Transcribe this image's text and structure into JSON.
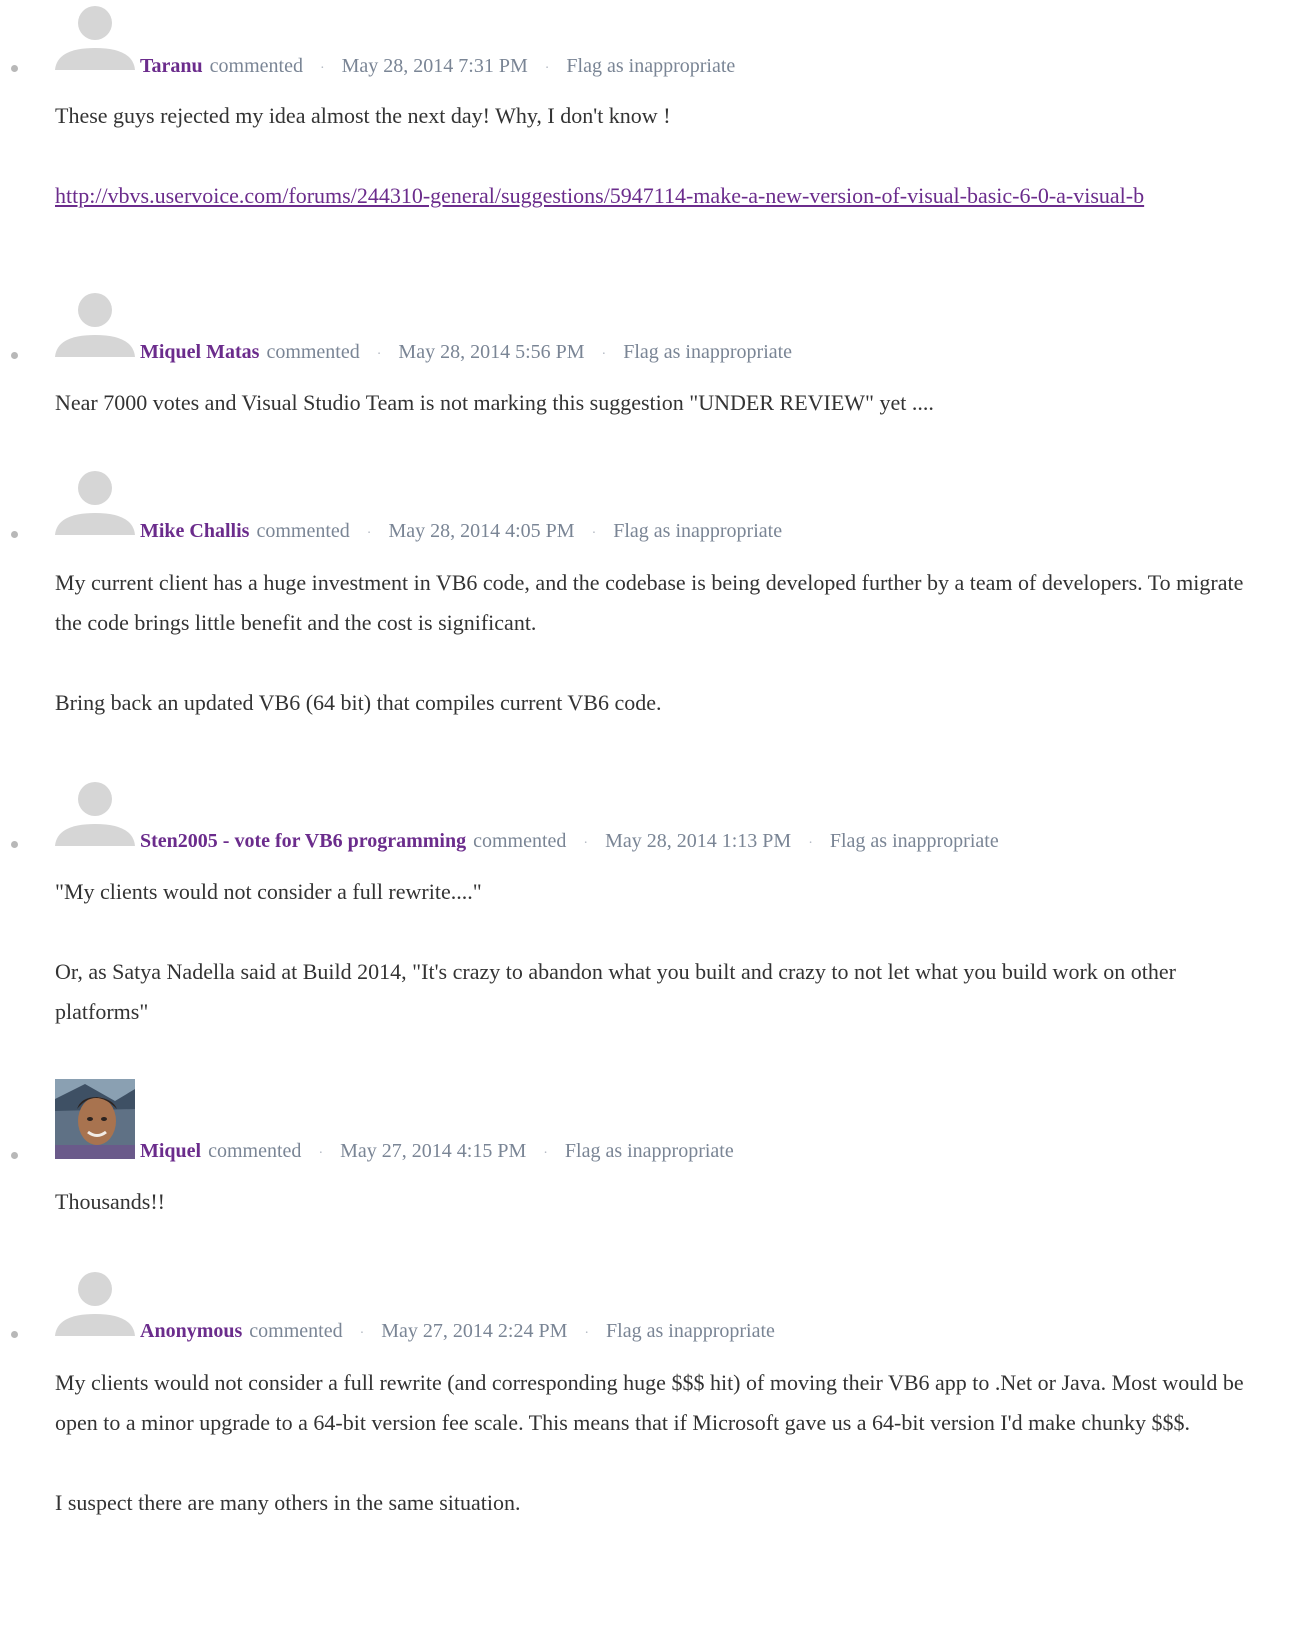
{
  "comments": [
    {
      "author": "Taranu",
      "verb": "commented",
      "date": "May 28, 2014 7:31 PM",
      "flag": "Flag as inappropriate",
      "avatar": "default-avatar",
      "paragraphs": [
        "These guys rejected my idea almost the next day! Why, I don't know !"
      ],
      "link": "http://vbvs.uservoice.com/forums/244310-general/suggestions/5947114-make-a-new-version-of-visual-basic-6-0-a-visual-b"
    },
    {
      "author": "Miquel Matas",
      "verb": "commented",
      "date": "May 28, 2014 5:56 PM",
      "flag": "Flag as inappropriate",
      "avatar": "default-avatar",
      "paragraphs": [
        "Near 7000 votes and Visual Studio Team is not marking this suggestion \"UNDER REVIEW\" yet ...."
      ]
    },
    {
      "author": "Mike Challis",
      "verb": "commented",
      "date": "May 28, 2014 4:05 PM",
      "flag": "Flag as inappropriate",
      "avatar": "default-avatar",
      "paragraphs": [
        "My current client has a huge investment in VB6 code, and the codebase is being developed further by a team of developers. To migrate the code brings little benefit and the cost is significant.",
        "Bring back an updated VB6 (64 bit) that compiles current VB6 code."
      ]
    },
    {
      "author": "Sten2005 - vote for VB6 programming",
      "verb": "commented",
      "date": "May 28, 2014 1:13 PM",
      "flag": "Flag as inappropriate",
      "avatar": "default-avatar",
      "paragraphs": [
        "\"My clients would not consider a full rewrite....\"",
        "Or, as Satya Nadella said at Build 2014, \"It's crazy to abandon what you built and crazy to not let what you build work on other platforms\""
      ]
    },
    {
      "author": "Miquel",
      "verb": "commented",
      "date": "May 27, 2014 4:15 PM",
      "flag": "Flag as inappropriate",
      "avatar": "user-photo",
      "paragraphs": [
        "Thousands!!"
      ]
    },
    {
      "author": "Anonymous",
      "verb": "commented",
      "date": "May 27, 2014 2:24 PM",
      "flag": "Flag as inappropriate",
      "avatar": "default-avatar",
      "paragraphs": [
        "My clients would not consider a full rewrite (and corresponding huge $$$ hit) of moving their VB6 app to .Net or Java. Most would be open to a minor upgrade to a 64-bit version fee scale. This means that if Microsoft gave us a 64-bit version I'd make chunky $$$.",
        "I suspect there are many others in the same situation."
      ]
    }
  ],
  "colors": {
    "author": "#6b2c8c",
    "meta": "#7a8595",
    "body": "#333333",
    "link": "#6b2c8c",
    "bullet": "#b8b8b8",
    "placeholder_avatar": "#d6d6d6"
  }
}
